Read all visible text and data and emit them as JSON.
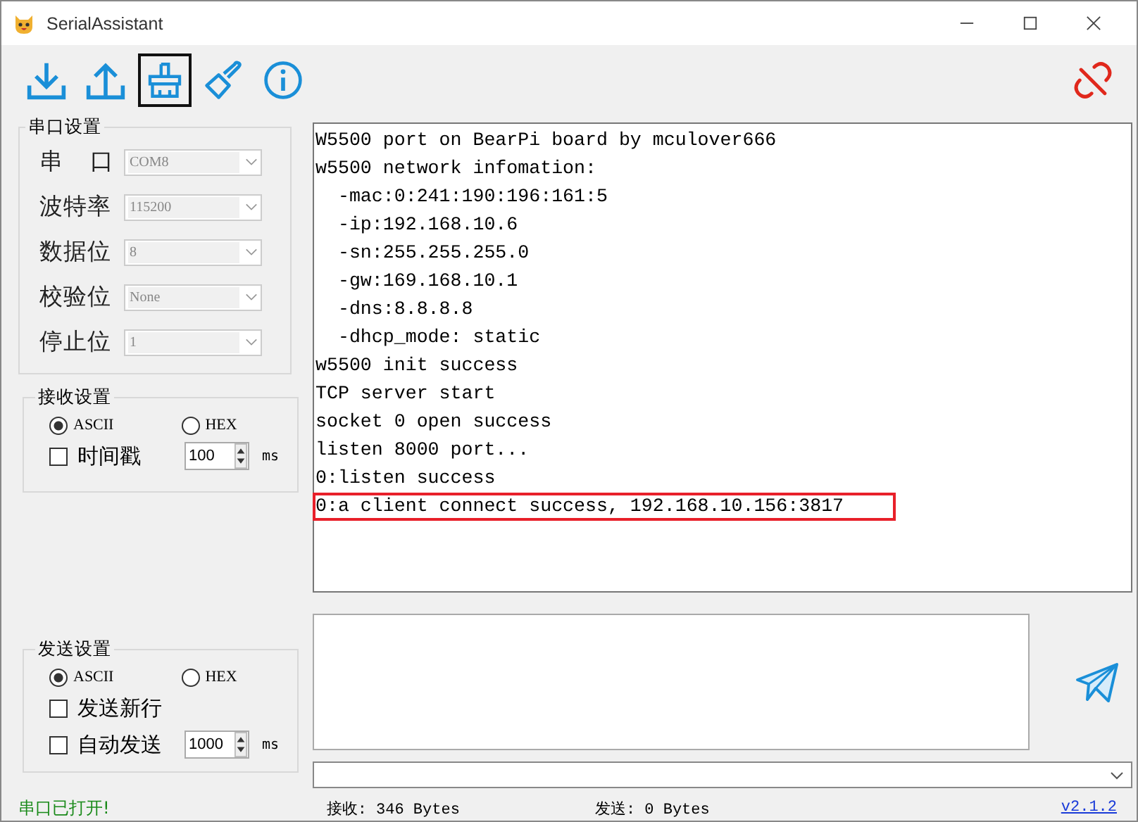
{
  "window": {
    "title": "SerialAssistant"
  },
  "toolbar": {
    "buttons": [
      {
        "kind": "download",
        "selected": false
      },
      {
        "kind": "upload",
        "selected": false
      },
      {
        "kind": "broom",
        "selected": true
      },
      {
        "kind": "brush",
        "selected": false
      },
      {
        "kind": "info",
        "selected": false
      }
    ],
    "connection": {
      "connected": false
    }
  },
  "serial_settings": {
    "title": "串口设置",
    "fields": [
      {
        "label": "串 口",
        "value": "COM8",
        "disabled": true
      },
      {
        "label": "波特率",
        "value": "115200",
        "disabled": true
      },
      {
        "label": "数据位",
        "value": "8",
        "disabled": true
      },
      {
        "label": "校验位",
        "value": "None",
        "disabled": true
      },
      {
        "label": "停止位",
        "value": "1",
        "disabled": true
      }
    ]
  },
  "receive_settings": {
    "title": "接收设置",
    "modes": [
      {
        "label": "ASCII",
        "selected": true
      },
      {
        "label": "HEX",
        "selected": false
      }
    ],
    "options": [
      {
        "kind": "spin",
        "label": "时间戳",
        "checked": false,
        "value": "100",
        "unit": "ms"
      }
    ]
  },
  "log": {
    "lines": [
      {
        "text": "W5500 port on BearPi board by mculover666",
        "highlighted": false
      },
      {
        "text": "w5500 network infomation:",
        "highlighted": false
      },
      {
        "text": "  -mac:0:241:190:196:161:5",
        "highlighted": false
      },
      {
        "text": "  -ip:192.168.10.6",
        "highlighted": false
      },
      {
        "text": "  -sn:255.255.255.0",
        "highlighted": false
      },
      {
        "text": "  -gw:169.168.10.1",
        "highlighted": false
      },
      {
        "text": "  -dns:8.8.8.8",
        "highlighted": false
      },
      {
        "text": "  -dhcp_mode: static",
        "highlighted": false
      },
      {
        "text": "w5500 init success",
        "highlighted": false
      },
      {
        "text": "TCP server start",
        "highlighted": false
      },
      {
        "text": "socket 0 open success",
        "highlighted": false
      },
      {
        "text": "listen 8000 port...",
        "highlighted": false
      },
      {
        "text": "0:listen success",
        "highlighted": false
      },
      {
        "text": "0:a client connect success, 192.168.10.156:3817",
        "highlighted": true
      }
    ]
  },
  "send_settings": {
    "title": "发送设置",
    "modes": [
      {
        "label": "ASCII",
        "selected": true
      },
      {
        "label": "HEX",
        "selected": false
      }
    ],
    "options": [
      {
        "kind": "plain",
        "label": "发送新行",
        "checked": false
      },
      {
        "kind": "spin",
        "label": "自动发送",
        "checked": false,
        "value": "1000",
        "unit": "ms"
      }
    ]
  },
  "status_bar": {
    "status": "串口已打开!",
    "received": "接收: 346 Bytes",
    "sent": "发送: 0 Bytes",
    "version": "v2.1.2"
  }
}
